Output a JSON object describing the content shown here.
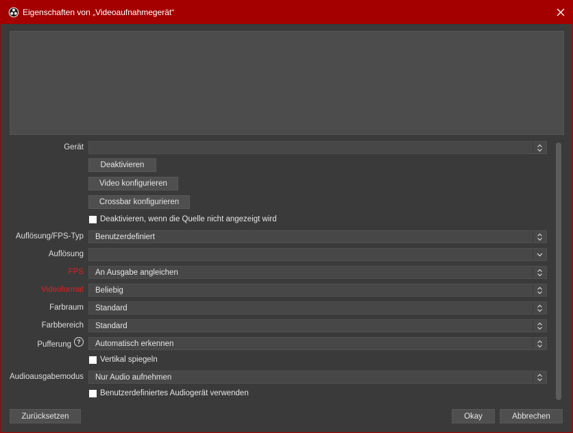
{
  "window": {
    "title": "Eigenschaften von „Videoaufnahmegerät“",
    "icon": "obs-logo-icon",
    "close_icon": "close-icon"
  },
  "device": {
    "label": "Gerät",
    "value": "",
    "buttons": {
      "deactivate": "Deaktivieren",
      "configure_video": "Video konfigurieren",
      "configure_crossbar": "Crossbar konfigurieren"
    },
    "deactivate_when_hidden": {
      "label": "Deaktivieren, wenn die Quelle nicht angezeigt wird",
      "checked": false
    }
  },
  "fields": {
    "res_fps_type": {
      "label": "Auflösung/FPS-Typ",
      "value": "Benutzerdefiniert"
    },
    "resolution": {
      "label": "Auflösung",
      "value": ""
    },
    "fps": {
      "label": "FPS",
      "value": "An Ausgabe angleichen"
    },
    "video_format": {
      "label": "Videoformat",
      "value": "Beliebig"
    },
    "color_space": {
      "label": "Farbraum",
      "value": "Standard"
    },
    "color_range": {
      "label": "Farbbereich",
      "value": "Standard"
    },
    "buffering": {
      "label": "Pufferung",
      "value": "Automatisch erkennen"
    },
    "audio_output_mode": {
      "label": "Audioausgabemodus",
      "value": "Nur Audio aufnehmen"
    }
  },
  "checkboxes": {
    "flip_vertical": {
      "label": "Vertikal spiegeln",
      "checked": false
    },
    "custom_audio_device": {
      "label": "Benutzerdefiniertes Audiogerät verwenden",
      "checked": false
    }
  },
  "footer": {
    "reset": "Zurücksetzen",
    "ok": "Okay",
    "cancel": "Abbrechen"
  },
  "colors": {
    "titlebar": "#a50000",
    "background": "#3a3a3a",
    "warning_label": "#e02020"
  }
}
